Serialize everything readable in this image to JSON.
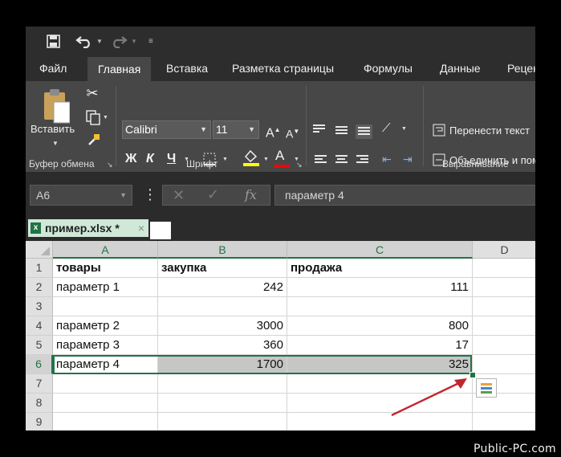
{
  "tabs": {
    "file": "Файл",
    "home": "Главная",
    "insert": "Вставка",
    "page_layout": "Разметка страницы",
    "formulas": "Формулы",
    "data": "Данные",
    "review": "Рецен"
  },
  "ribbon": {
    "paste_label": "Вставить",
    "clipboard_group": "Буфер обмена",
    "font_group": "Шрифт",
    "alignment_group": "Выравнивание",
    "font_name": "Calibri",
    "font_size": "11",
    "bold": "Ж",
    "italic": "К",
    "underline": "Ч",
    "grow_font": "A",
    "shrink_font": "A",
    "font_color": "A",
    "wrap_text": "Перенести текст",
    "merge_center": "Объединить и поместить в центре"
  },
  "formula_bar": {
    "name_box": "A6",
    "fx": "fx",
    "value": "параметр 4"
  },
  "workbook_tab": {
    "name": "пример.xlsx *",
    "close": "×"
  },
  "sheet": {
    "columns": [
      "A",
      "B",
      "C",
      "D"
    ],
    "rows": [
      {
        "n": "1",
        "a": "товары",
        "b": "закупка",
        "c": "продажа"
      },
      {
        "n": "2",
        "a": "параметр 1",
        "b": "242",
        "c": "111"
      },
      {
        "n": "3",
        "a": "",
        "b": "",
        "c": ""
      },
      {
        "n": "4",
        "a": "параметр 2",
        "b": "3000",
        "c": "800"
      },
      {
        "n": "5",
        "a": "параметр 3",
        "b": "360",
        "c": "17"
      },
      {
        "n": "6",
        "a": "параметр 4",
        "b": "1700",
        "c": "325"
      },
      {
        "n": "7",
        "a": "",
        "b": "",
        "c": ""
      },
      {
        "n": "8",
        "a": "",
        "b": "",
        "c": ""
      },
      {
        "n": "9",
        "a": "",
        "b": "",
        "c": ""
      }
    ]
  },
  "colors": {
    "accent_green": "#217346",
    "selection_gray": "#c6c6c6",
    "arrow_red": "#c0272d"
  },
  "watermark": "Public-PC.com"
}
